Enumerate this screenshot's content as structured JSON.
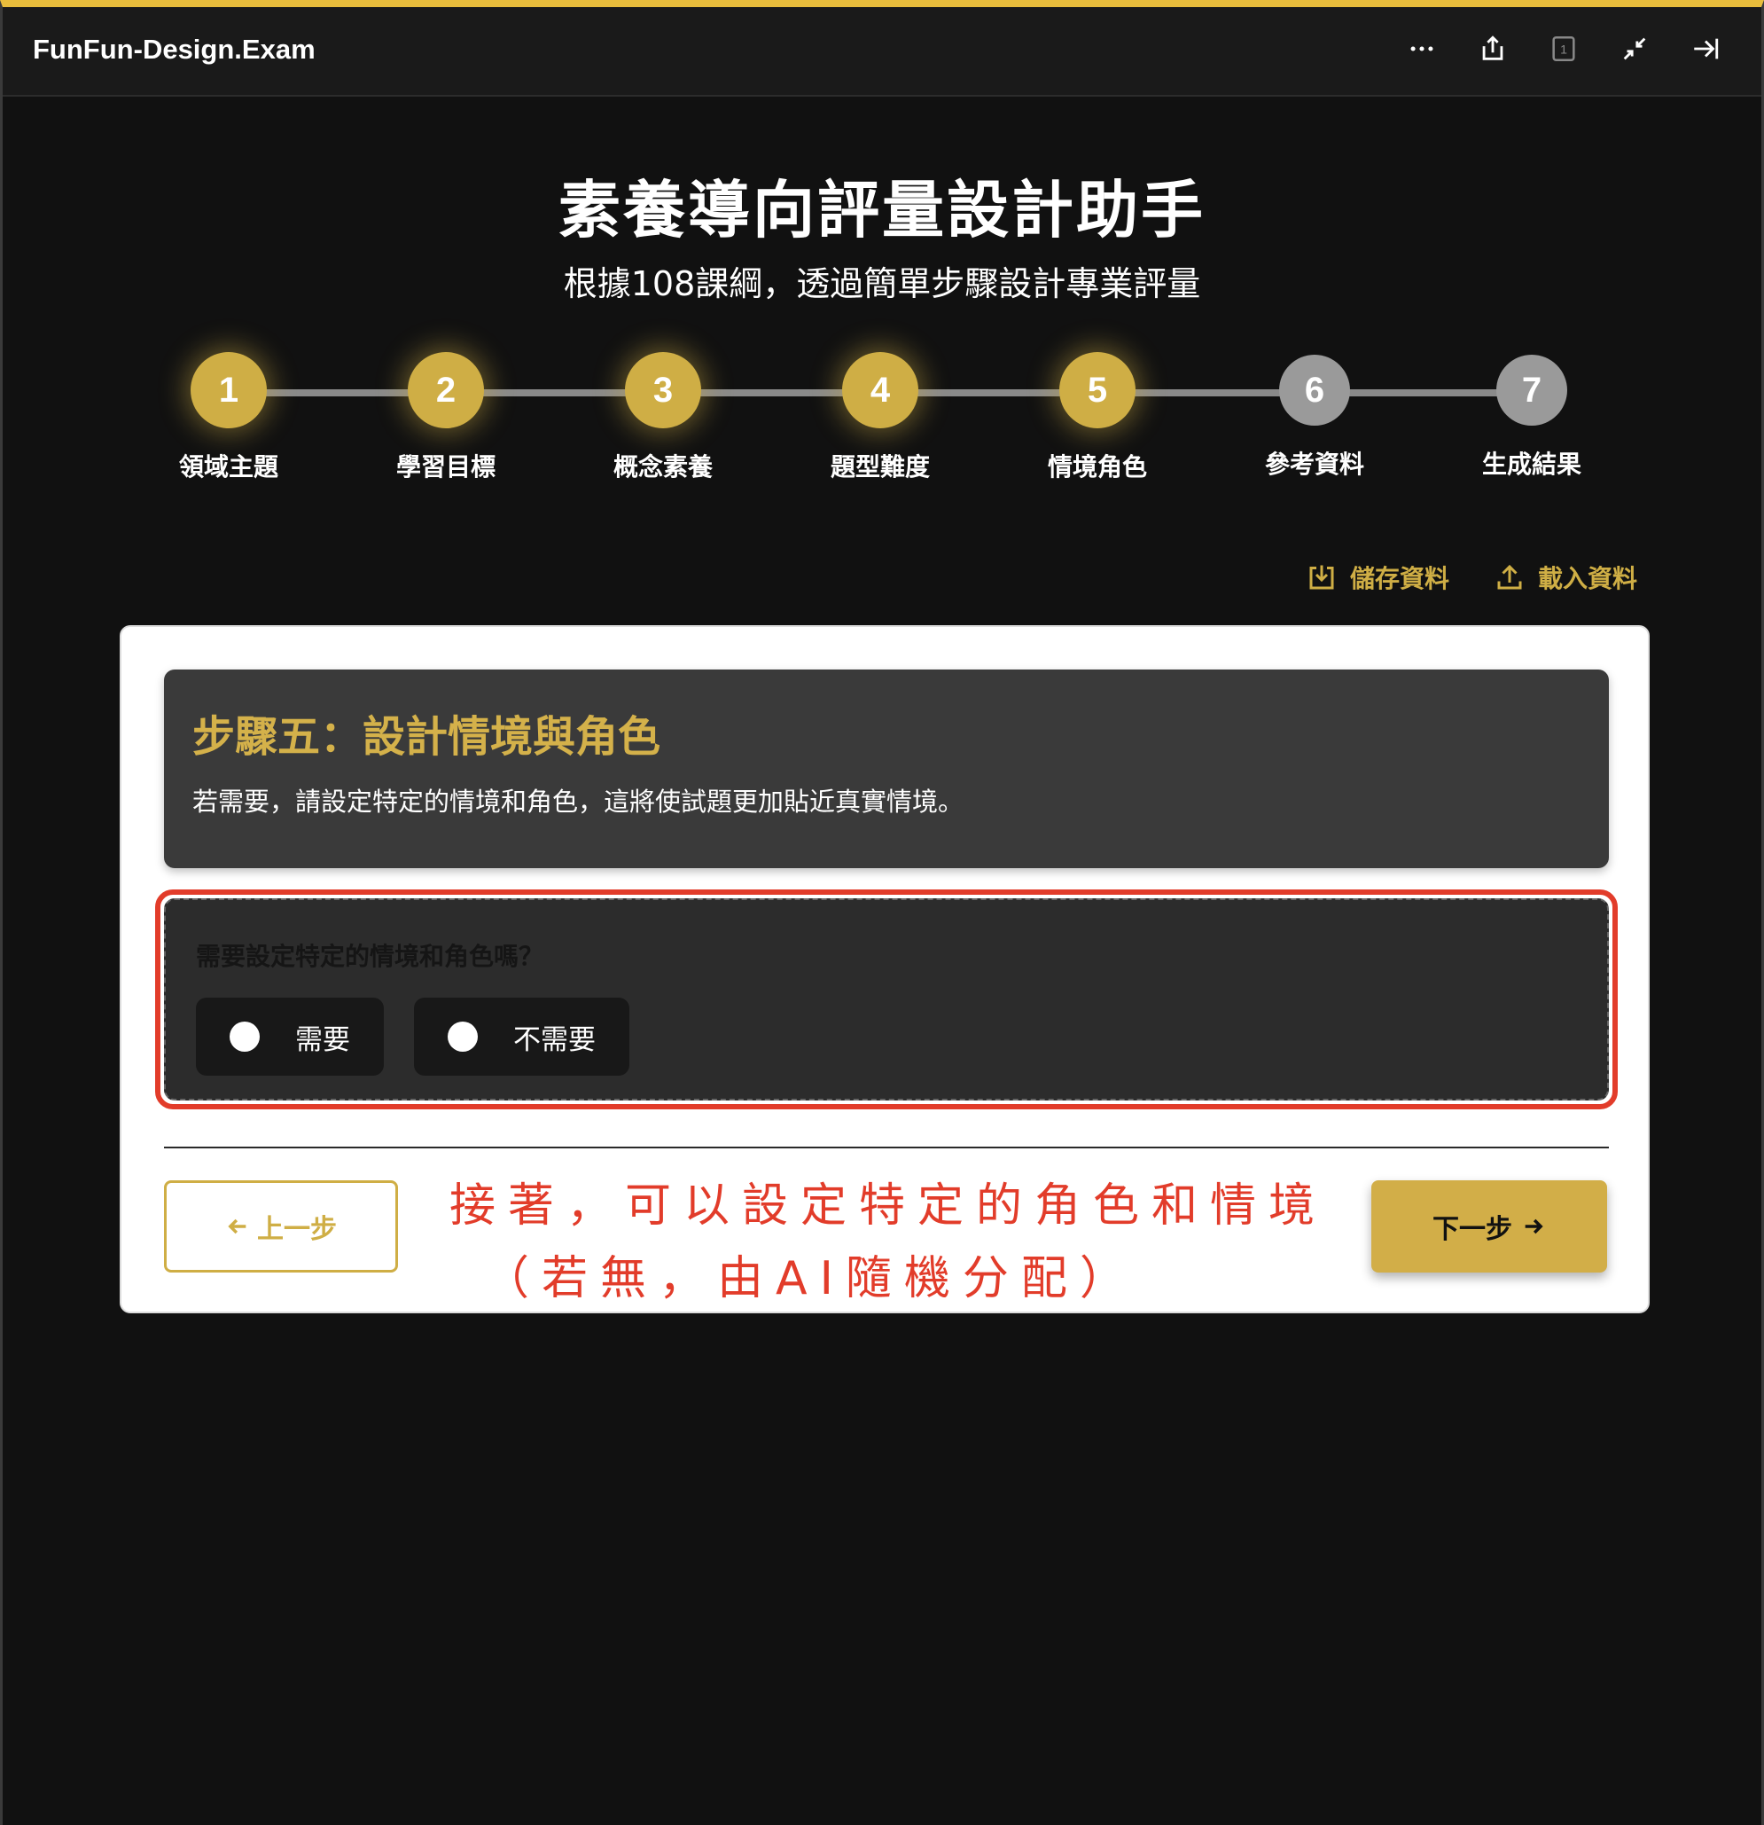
{
  "window": {
    "title": "FunFun-Design.Exam",
    "toolbar_icons": [
      "more-icon",
      "share-icon",
      "tab-count-icon",
      "collapse-icon",
      "close-panel-icon"
    ],
    "tab_count": "1"
  },
  "header": {
    "title": "素養導向評量設計助手",
    "subtitle": "根據108課綱，透過簡單步驟設計專業評量"
  },
  "stepper": {
    "current": 5,
    "steps": [
      {
        "number": "1",
        "label": "領域主題"
      },
      {
        "number": "2",
        "label": "學習目標"
      },
      {
        "number": "3",
        "label": "概念素養"
      },
      {
        "number": "4",
        "label": "題型難度"
      },
      {
        "number": "5",
        "label": "情境角色"
      },
      {
        "number": "6",
        "label": "參考資料"
      },
      {
        "number": "7",
        "label": "生成結果"
      }
    ]
  },
  "data_actions": {
    "save_label": "儲存資料",
    "load_label": "載入資料"
  },
  "step_intro": {
    "title": "步驟五：設計情境與角色",
    "description": "若需要，請設定特定的情境和角色，這將使試題更加貼近真實情境。"
  },
  "question": {
    "label": "需要設定特定的情境和角色嗎？",
    "options": [
      {
        "label": "需要",
        "selected": false
      },
      {
        "label": "不需要",
        "selected": false
      }
    ]
  },
  "navigation": {
    "prev_label": "上一步",
    "next_label": "下一步"
  },
  "annotation": {
    "line1": "接著，可以設定特定的角色和情境",
    "line2": "（若無，由AI隨機分配）"
  },
  "colors": {
    "accent": "#cfae45",
    "top_border": "#e9bd3c",
    "annotation": "#e23c2a",
    "inactive_step": "#9a9a9a"
  }
}
